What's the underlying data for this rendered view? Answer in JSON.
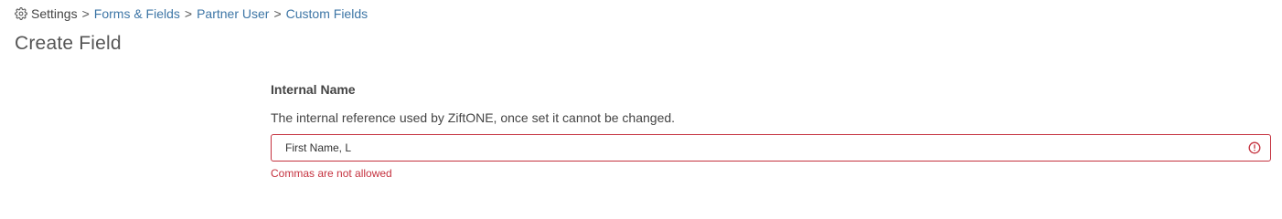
{
  "breadcrumb": {
    "root": "Settings",
    "separator": ">",
    "links": [
      "Forms & Fields",
      "Partner User",
      "Custom Fields"
    ]
  },
  "page": {
    "title": "Create Field"
  },
  "field": {
    "label": "Internal Name",
    "help": "The internal reference used by ZiftONE, once set it cannot be changed.",
    "value": "First Name, L",
    "error": "Commas are not allowed",
    "error_color": "#c5323f"
  },
  "colors": {
    "link": "#3e76a6",
    "text": "#444444"
  },
  "icons": {
    "breadcrumb_root": "gear-icon",
    "field_status": "alert-circle-icon"
  }
}
